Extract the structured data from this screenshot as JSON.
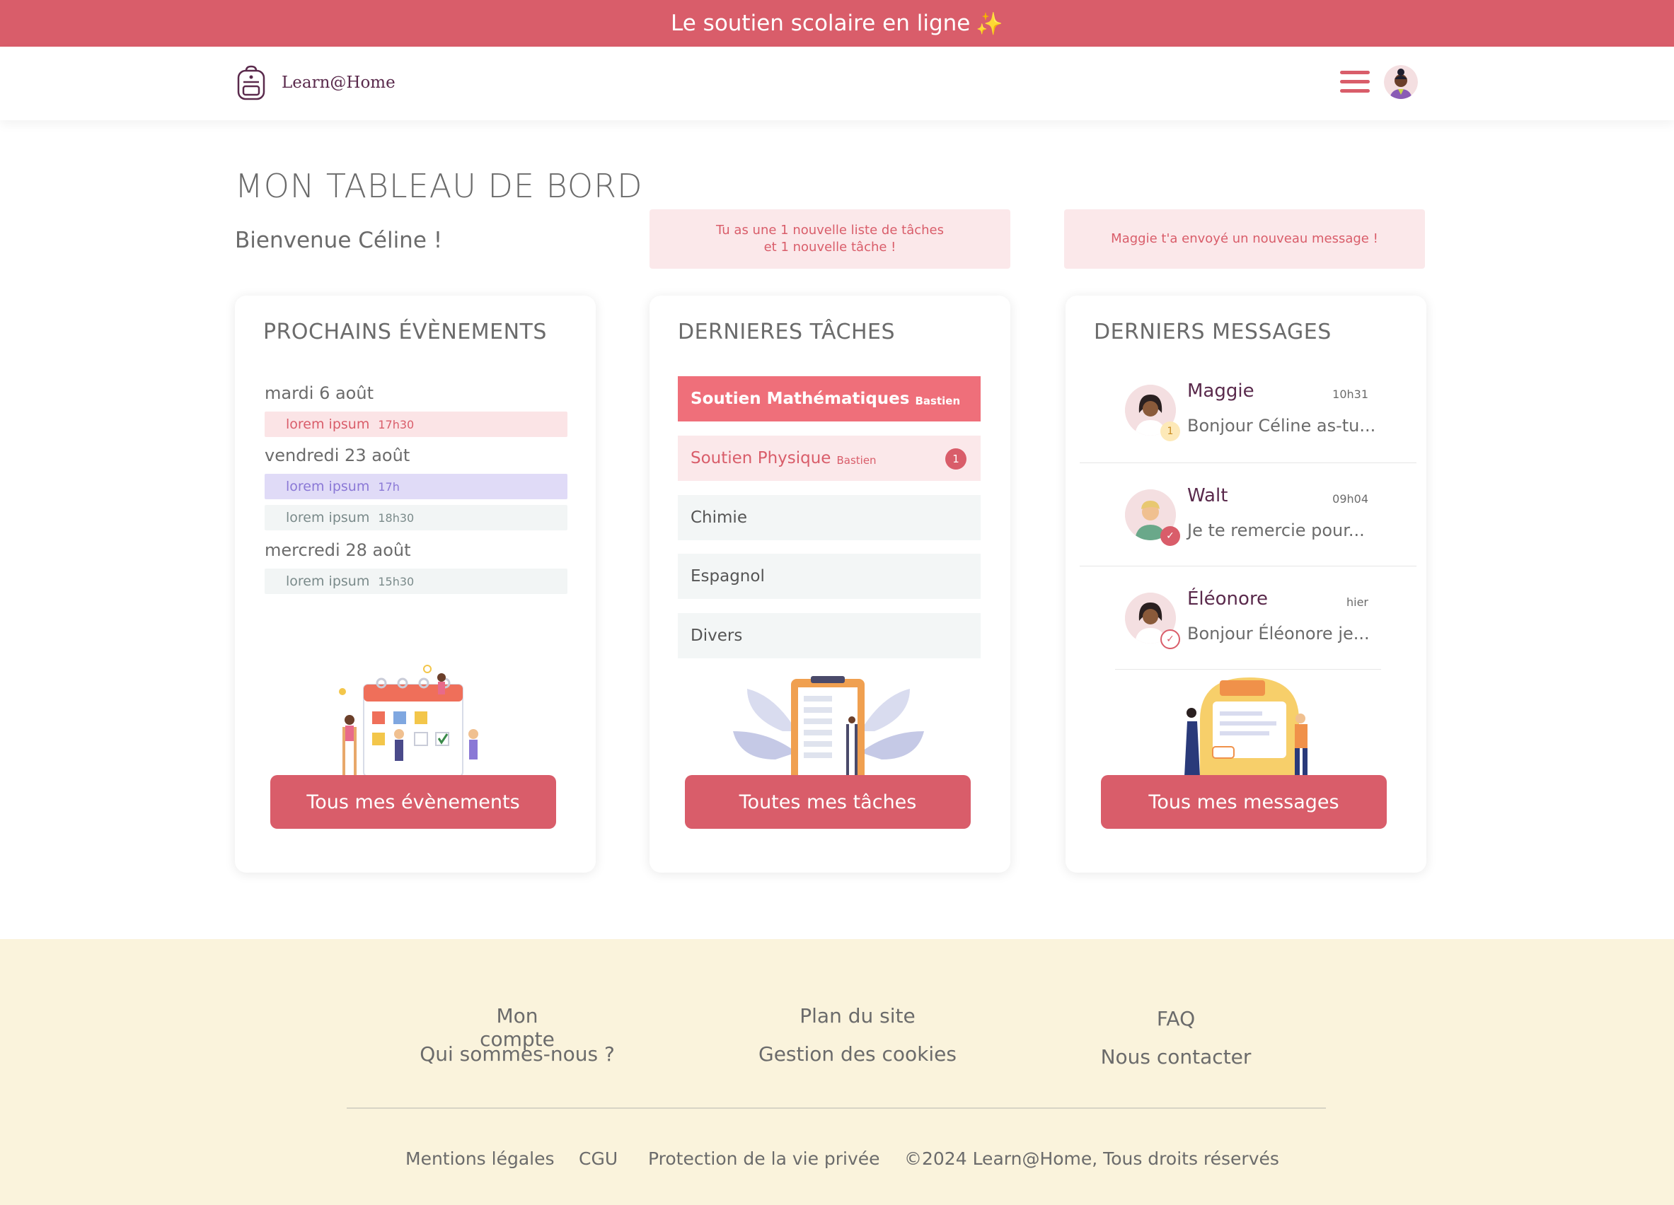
{
  "banner": {
    "text": "Le soutien scolaire en ligne",
    "emoji": "✨"
  },
  "header": {
    "brand": "Learn@Home",
    "menu_icon": "hamburger-menu-icon",
    "avatar_icon": "user-avatar-icon"
  },
  "page": {
    "title": "MON TABLEAU DE BORD",
    "welcome": "Bienvenue Céline !",
    "notifications": [
      {
        "line1": "Tu as une 1 nouvelle liste de tâches",
        "line2": "et 1 nouvelle tâche !"
      },
      {
        "line1": "Maggie t'a envoyé un nouveau message !"
      }
    ]
  },
  "events": {
    "title": "PROCHAINS ÉVÈNEMENTS",
    "days": [
      {
        "date": "mardi 6 août",
        "items": [
          {
            "label": "lorem ipsum",
            "time": "17h30",
            "color": "pink"
          }
        ]
      },
      {
        "date": "vendredi 23 août",
        "items": [
          {
            "label": "lorem ipsum",
            "time": "17h",
            "color": "purple"
          },
          {
            "label": "lorem ipsum",
            "time": "18h30",
            "color": "grey"
          }
        ]
      },
      {
        "date": "mercredi 28 août",
        "items": [
          {
            "label": "lorem ipsum",
            "time": "15h30",
            "color": "grey"
          }
        ]
      }
    ],
    "button": "Tous mes évènements"
  },
  "tasks": {
    "title": "DERNIERES TÂCHES",
    "items": [
      {
        "label": "Soutien Mathématiques",
        "sub": "Bastien",
        "state": "active"
      },
      {
        "label": "Soutien Physique",
        "sub": "Bastien",
        "badge": "1",
        "state": "pink"
      },
      {
        "label": "Chimie",
        "state": "grey"
      },
      {
        "label": "Espagnol",
        "state": "grey"
      },
      {
        "label": "Divers",
        "state": "grey"
      }
    ],
    "button": "Toutes mes tâches"
  },
  "messages": {
    "title": "DERNIERS MESSAGES",
    "items": [
      {
        "name": "Maggie",
        "time": "10h31",
        "preview": "Bonjour Céline as-tu...",
        "status": "1"
      },
      {
        "name": "Walt",
        "time": "09h04",
        "preview": "Je te remercie pour...",
        "status": "read"
      },
      {
        "name": "Éléonore",
        "time": "hier",
        "preview": "Bonjour Éléonore je...",
        "status": "sent"
      }
    ],
    "button": "Tous mes messages"
  },
  "footer": {
    "col1": [
      "Mon compte",
      "Qui sommes-nous ?"
    ],
    "col2": [
      "Plan du site",
      "Gestion des cookies"
    ],
    "col3": [
      "FAQ",
      "Nous contacter"
    ],
    "bottom": [
      "Mentions légales",
      "CGU",
      "Protection de la vie privée",
      "©2024 Learn@Home, Tous droits réservés"
    ]
  },
  "colors": {
    "brand": "#d95d6a",
    "footer_bg": "#faf3dc",
    "dark_purple": "#5a2a4c"
  }
}
